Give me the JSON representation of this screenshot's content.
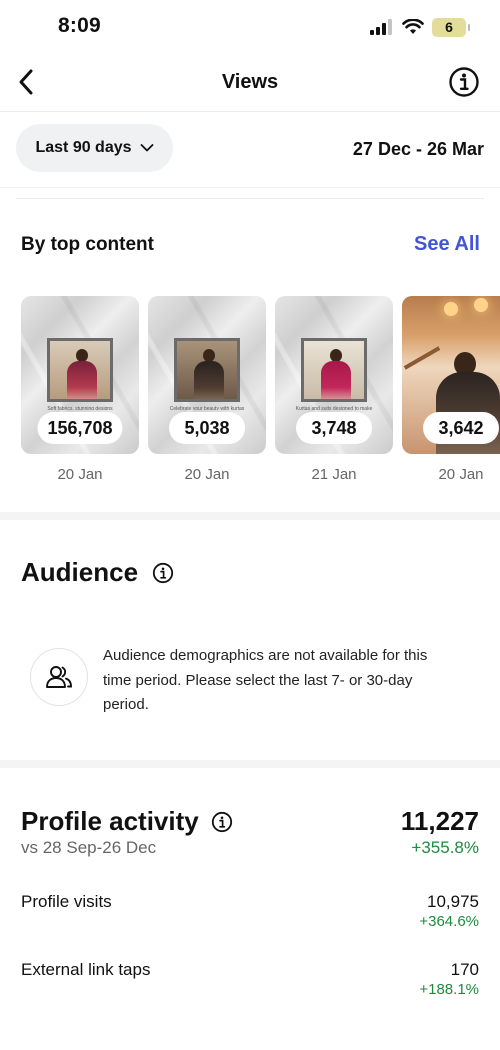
{
  "status_bar": {
    "time": "8:09",
    "battery": "6"
  },
  "header": {
    "title": "Views"
  },
  "filters": {
    "range_label": "Last 90 days",
    "date_range": "27 Dec - 26 Mar"
  },
  "top_content": {
    "title": "By top content",
    "see_all": "See All",
    "items": [
      {
        "count": "156,708",
        "date": "20 Jan",
        "caption": "Soft fabrics, stunning designs"
      },
      {
        "count": "5,038",
        "date": "20 Jan",
        "caption": "Celebrate your beauty with kurtas"
      },
      {
        "count": "3,748",
        "date": "21 Jan",
        "caption": "Kurtas and suits designed to make"
      },
      {
        "count": "3,642",
        "date": "20 Jan"
      }
    ]
  },
  "audience": {
    "title": "Audience",
    "message": "Audience demographics are not available for this time period. Please select the last 7- or 30-day period."
  },
  "profile_activity": {
    "title": "Profile activity",
    "comparison": "vs 28 Sep-26 Dec",
    "total": "11,227",
    "total_change": "+355.8%",
    "metrics": [
      {
        "label": "Profile visits",
        "value": "10,975",
        "change": "+364.6%"
      },
      {
        "label": "External link taps",
        "value": "170",
        "change": "+188.1%"
      }
    ]
  },
  "colors": {
    "accent": "#4056d6",
    "positive": "#1f8a3e",
    "pill_bg": "#eff1f3"
  }
}
